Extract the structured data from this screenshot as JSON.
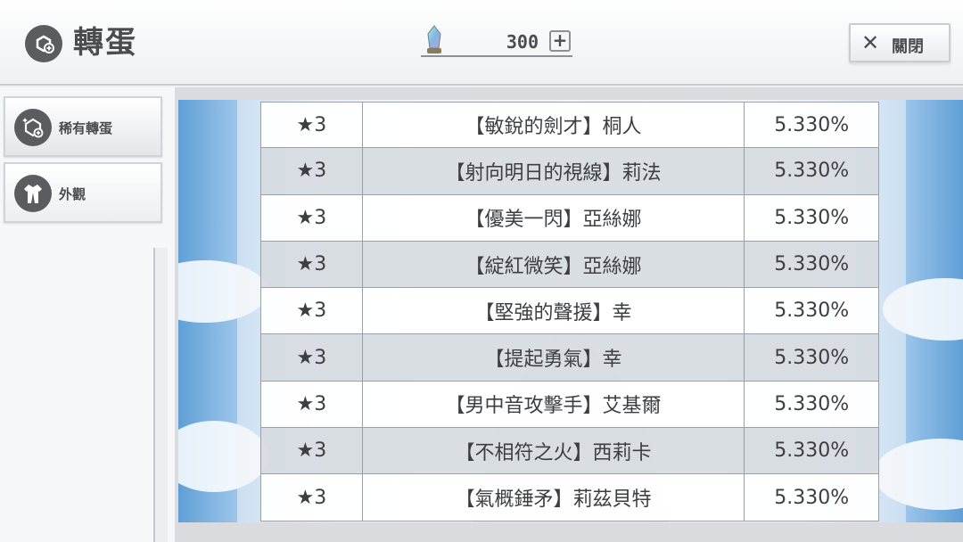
{
  "header": {
    "title": "轉蛋",
    "title_icon": "gacha-capsule-icon",
    "currency": {
      "icon": "crystal-icon",
      "value": "300",
      "plus_label": "+"
    },
    "close": {
      "icon": "close-icon",
      "label": "關閉"
    }
  },
  "sidebar": {
    "items": [
      {
        "label": "稀有轉蛋",
        "icon": "rare-gacha-icon",
        "active": true
      },
      {
        "label": "外觀",
        "icon": "costume-icon",
        "active": false
      }
    ]
  },
  "table": {
    "rows": [
      {
        "rarity": "★3",
        "name": "【敏銳的劍才】桐人",
        "rate": "5.330%"
      },
      {
        "rarity": "★3",
        "name": "【射向明日的視線】莉法",
        "rate": "5.330%"
      },
      {
        "rarity": "★3",
        "name": "【優美一閃】亞絲娜",
        "rate": "5.330%"
      },
      {
        "rarity": "★3",
        "name": "【綻紅微笑】亞絲娜",
        "rate": "5.330%"
      },
      {
        "rarity": "★3",
        "name": "【堅強的聲援】幸",
        "rate": "5.330%"
      },
      {
        "rarity": "★3",
        "name": "【提起勇氣】幸",
        "rate": "5.330%"
      },
      {
        "rarity": "★3",
        "name": "【男中音攻擊手】艾基爾",
        "rate": "5.330%"
      },
      {
        "rarity": "★3",
        "name": "【不相符之火】西莉卡",
        "rate": "5.330%"
      },
      {
        "rarity": "★3",
        "name": "【氣概錘矛】莉茲貝特",
        "rate": "5.330%"
      }
    ]
  },
  "colors": {
    "header_text": "#4a4c50",
    "sky_edge": "#5f9fd6",
    "row_alt": "#d6dbdf"
  }
}
